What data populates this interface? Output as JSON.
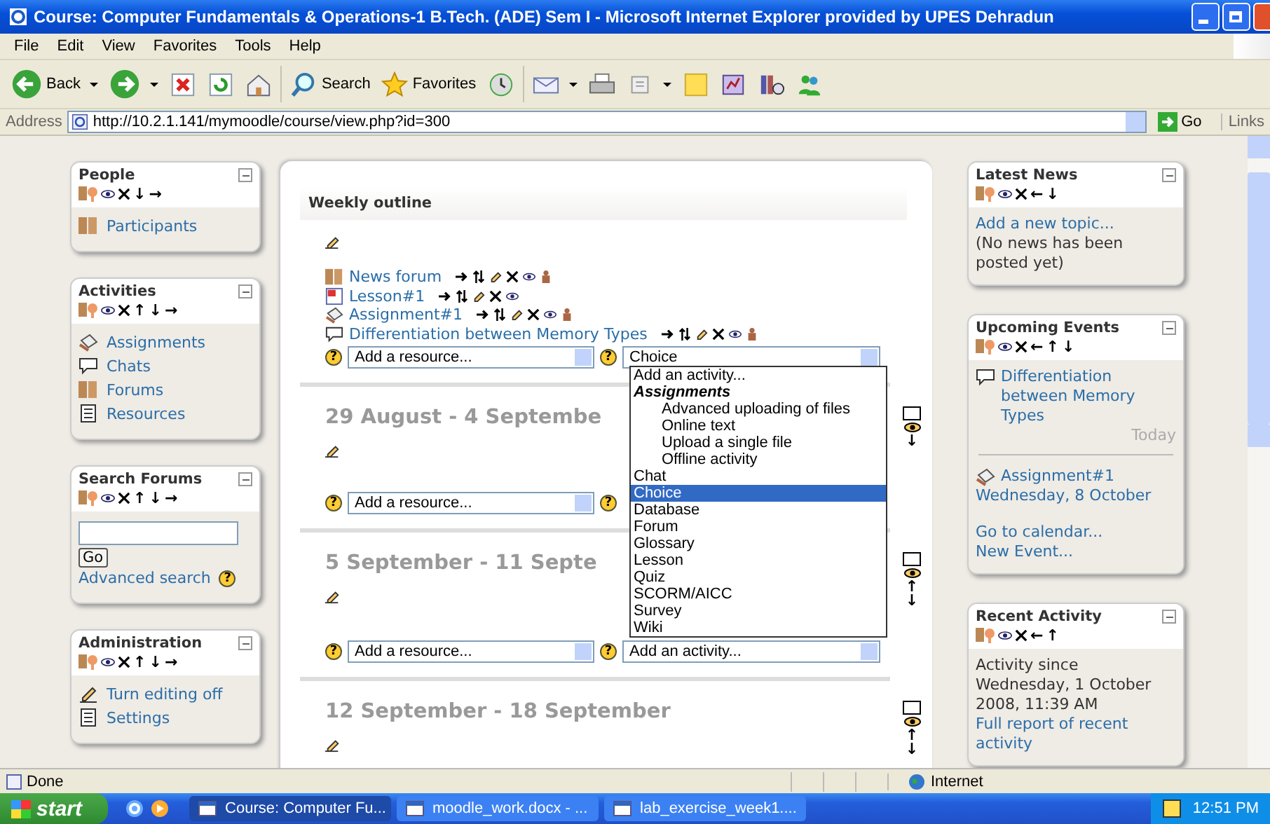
{
  "window": {
    "title": "Course: Computer Fundamentals & Operations-1 B.Tech. (ADE) Sem I - Microsoft Internet Explorer provided by UPES Dehradun"
  },
  "menu_bar": [
    "File",
    "Edit",
    "View",
    "Favorites",
    "Tools",
    "Help"
  ],
  "toolbar": [
    {
      "kind": "back",
      "label": "Back"
    },
    {
      "kind": "forward"
    },
    {
      "kind": "stop"
    },
    {
      "kind": "refresh"
    },
    {
      "kind": "home"
    },
    {
      "kind": "search",
      "label": "Search"
    },
    {
      "kind": "favorites",
      "label": "Favorites"
    },
    {
      "kind": "history"
    },
    {
      "kind": "mail"
    },
    {
      "kind": "print"
    },
    {
      "kind": "edit"
    },
    {
      "kind": "note"
    },
    {
      "kind": "messenger"
    },
    {
      "kind": "research"
    },
    {
      "kind": "people"
    }
  ],
  "address_bar": {
    "label": "Address",
    "url": "http://10.2.1.141/mymoodle/course/view.php?id=300",
    "go": "Go",
    "links": "Links"
  },
  "left_blocks": [
    {
      "kind": "links",
      "title": "People",
      "arrows": [
        "↓",
        "→"
      ],
      "items": [
        {
          "kind": "participants",
          "label": "Participants"
        }
      ]
    },
    {
      "kind": "links",
      "title": "Activities",
      "arrows": [
        "↑",
        "↓",
        "→"
      ],
      "items": [
        {
          "kind": "assignment",
          "label": "Assignments"
        },
        {
          "kind": "chat",
          "label": "Chats"
        },
        {
          "kind": "forum",
          "label": "Forums"
        },
        {
          "kind": "resource",
          "label": "Resources"
        }
      ]
    },
    {
      "kind": "search",
      "title": "Search Forums",
      "arrows": [
        "↑",
        "↓",
        "→"
      ],
      "button": "Go",
      "link": "Advanced search",
      "help": "?"
    },
    {
      "kind": "links",
      "title": "Administration",
      "arrows": [
        "↑",
        "↓",
        "→"
      ],
      "items": [
        {
          "kind": "edit",
          "label": "Turn editing off"
        },
        {
          "kind": "settings",
          "label": "Settings"
        }
      ]
    }
  ],
  "outline": {
    "title": "Weekly outline",
    "activities": [
      {
        "kind": "forum",
        "name": "News forum",
        "group_icon": true
      },
      {
        "kind": "lesson",
        "name": "Lesson#1",
        "group_icon": false
      },
      {
        "kind": "assignment",
        "name": "Assignment#1",
        "group_icon": true
      },
      {
        "kind": "chat",
        "name": "Differentiation between Memory Types",
        "group_icon": true
      }
    ],
    "resource_select": "Add a resource...",
    "activity_select": "Choice",
    "help": "?"
  },
  "weeks": [
    {
      "title": "29 August - 4 Septembe",
      "arrows": [
        "↓"
      ],
      "resource_select": "Add a resource...",
      "help": "?"
    },
    {
      "title": "5 September - 11 Septe",
      "arrows": [
        "↑",
        "↓"
      ],
      "resource_select": "Add a resource...",
      "activity_select": "Add an activity...",
      "help": "?"
    },
    {
      "title": "12 September - 18 September",
      "arrows": [
        "↑",
        "↓"
      ]
    }
  ],
  "activity_dropdown": [
    {
      "kind": "option",
      "label": "Add an activity...",
      "selected": false
    },
    {
      "kind": "group",
      "label": "Assignments",
      "selected": false
    },
    {
      "kind": "sub",
      "label": "Advanced uploading of files",
      "selected": false
    },
    {
      "kind": "sub",
      "label": "Online text",
      "selected": false
    },
    {
      "kind": "sub",
      "label": "Upload a single file",
      "selected": false
    },
    {
      "kind": "sub",
      "label": "Offline activity",
      "selected": false
    },
    {
      "kind": "option",
      "label": "Chat",
      "selected": false
    },
    {
      "kind": "option",
      "label": "Choice",
      "selected": true
    },
    {
      "kind": "option",
      "label": "Database",
      "selected": false
    },
    {
      "kind": "option",
      "label": "Forum",
      "selected": false
    },
    {
      "kind": "option",
      "label": "Glossary",
      "selected": false
    },
    {
      "kind": "option",
      "label": "Lesson",
      "selected": false
    },
    {
      "kind": "option",
      "label": "Quiz",
      "selected": false
    },
    {
      "kind": "option",
      "label": "SCORM/AICC",
      "selected": false
    },
    {
      "kind": "option",
      "label": "Survey",
      "selected": false
    },
    {
      "kind": "option",
      "label": "Wiki",
      "selected": false
    }
  ],
  "right_blocks": [
    {
      "kind": "news",
      "title": "Latest News",
      "arrows": [
        "←",
        "↓"
      ],
      "link": "Add a new topic...",
      "note": "(No news has been posted yet)"
    },
    {
      "kind": "events",
      "title": "Upcoming Events",
      "arrows": [
        "←",
        "↑",
        "↓"
      ],
      "events": [
        {
          "kind": "chat",
          "name": "Differentiation between Memory Types",
          "date": "Today",
          "date_link": false
        },
        {
          "kind": "assignment",
          "name": "Assignment#1",
          "date": "Wednesday, 8 October",
          "date_link": true
        }
      ],
      "links": [
        "Go to calendar...",
        "New Event..."
      ]
    },
    {
      "kind": "recent",
      "title": "Recent Activity",
      "arrows": [
        "←",
        "↑"
      ],
      "text": "Activity since Wednesday, 1 October 2008, 11:39 AM",
      "link": "Full report of recent activity"
    }
  ],
  "status_bar": {
    "text": "Done",
    "zone": "Internet"
  },
  "taskbar": {
    "start": "start",
    "tasks": [
      {
        "label": "Course: Computer Fu...",
        "selected": true
      },
      {
        "label": "moodle_work.docx - ...",
        "selected": false
      },
      {
        "label": "lab_exercise_week1....",
        "selected": false
      }
    ],
    "clock": "12:51 PM"
  }
}
